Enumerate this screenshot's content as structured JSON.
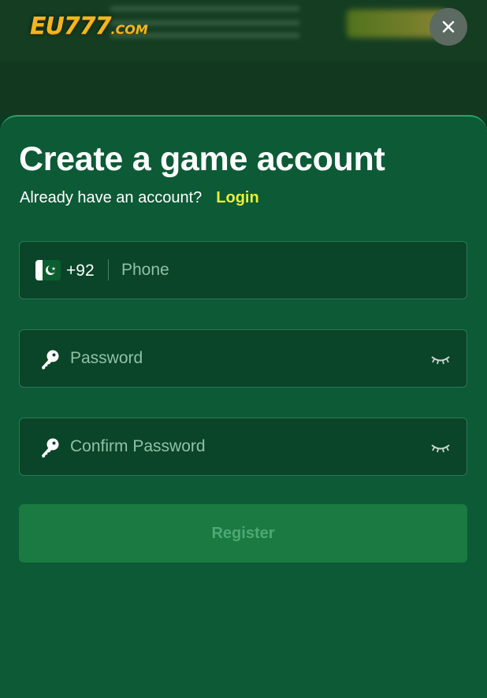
{
  "brand": {
    "logo_main": "EU777",
    "logo_suffix": ".COM"
  },
  "modal": {
    "title": "Create a game account",
    "account_prompt": "Already have an account?",
    "login_label": "Login",
    "phone": {
      "country_code": "+92",
      "placeholder": "Phone",
      "flag_icon": "pakistan-flag-icon"
    },
    "password": {
      "placeholder": "Password"
    },
    "confirm_password": {
      "placeholder": "Confirm Password"
    },
    "register_label": "Register"
  },
  "colors": {
    "accent_login": "#e8f03a",
    "sheet_bg": "#0d5a36",
    "input_bg": "#0a4429",
    "register_bg": "#1a7a42",
    "logo_gold": "#f2b51f"
  }
}
